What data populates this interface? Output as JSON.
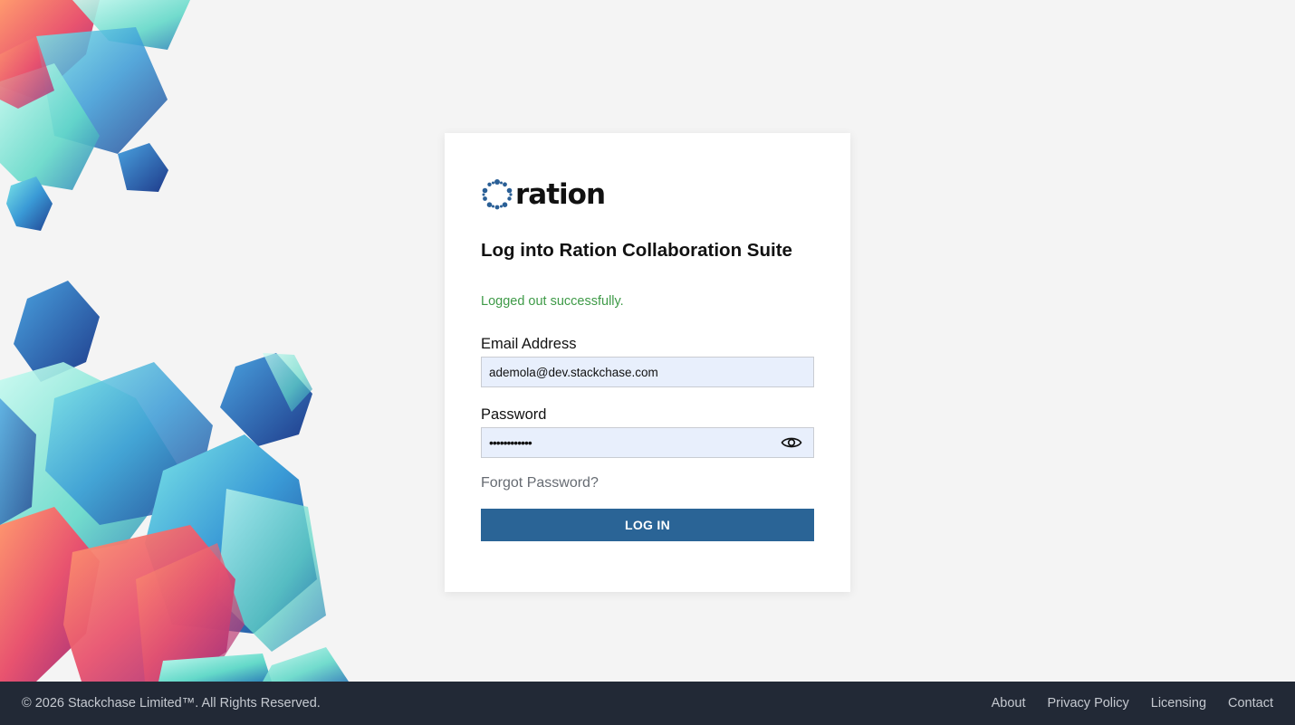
{
  "brand": {
    "logo_text": "ration",
    "logo_mark_icon": "dotted-ring-icon",
    "accent_color": "#2a6496"
  },
  "login": {
    "title": "Log into Ration Collaboration Suite",
    "status_message": "Logged out successfully.",
    "status_color": "#3e9a47",
    "email_label": "Email Address",
    "email_value": "ademola@dev.stackchase.com",
    "password_label": "Password",
    "password_masked": "••••••••••••",
    "password_toggle_icon": "eye-icon",
    "forgot_password": "Forgot Password?",
    "submit_label": "LOG IN"
  },
  "footer": {
    "copyright": "© 2026 Stackchase Limited™. All Rights Reserved.",
    "links": [
      "About",
      "Privacy Policy",
      "Licensing",
      "Contact"
    ]
  }
}
